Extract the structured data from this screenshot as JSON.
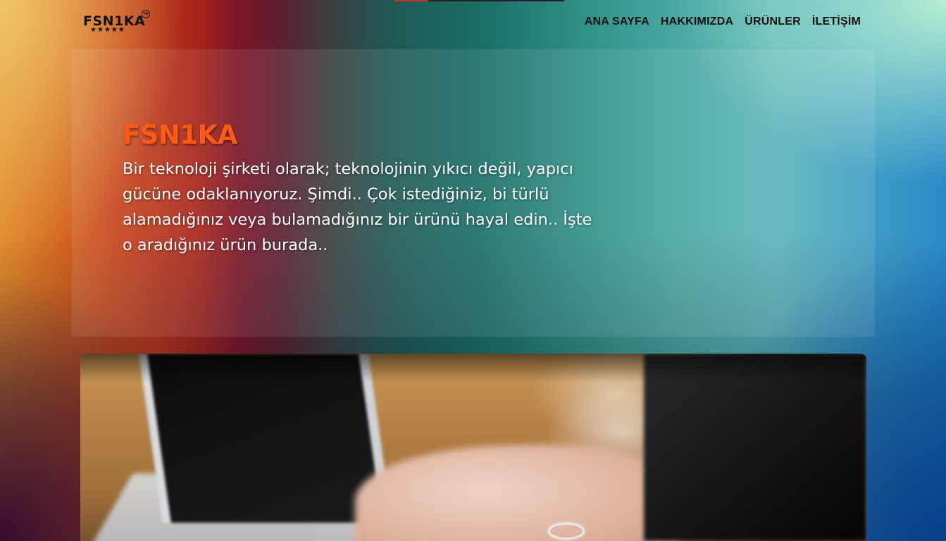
{
  "header": {
    "logo": {
      "text": "FSN1KA",
      "stars": "★★★★★",
      "tm": "TM"
    },
    "nav": [
      {
        "label": "ANA SAYFA"
      },
      {
        "label": "HAKKIMIZDA"
      },
      {
        "label": "ÜRÜNLER"
      },
      {
        "label": "İLETİŞİM"
      }
    ]
  },
  "hero": {
    "title": "FSN1KA",
    "text": "Bir teknoloji şirketi olarak; teknolojinin yıkıcı değil, yapıcı gücüne odaklanıyoruz. Şimdi.. Çok istediğiniz, bi türlü alamadığınız veya bulamadığınız bir ürünü hayal edin.. İşte o aradığınız ürün burada.."
  },
  "colors": {
    "title_accent": "#ff5a14",
    "nav_text": "#111111",
    "hero_text": "#ffffff",
    "topbar_red": "#c83228"
  },
  "icons": {
    "logo_stars": "star-icon"
  }
}
